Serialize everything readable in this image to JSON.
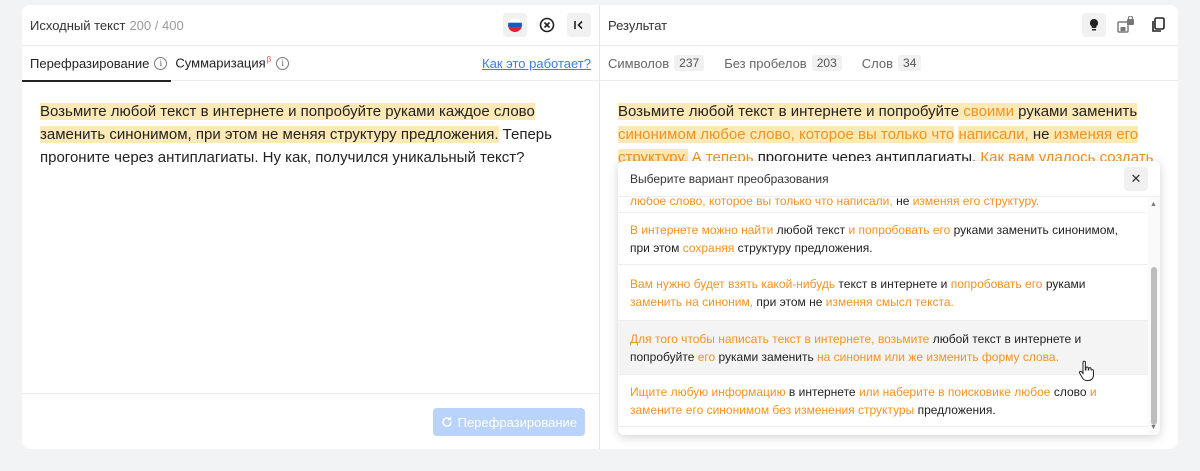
{
  "left": {
    "title": "Исходный текст",
    "counter": "200 / 400",
    "tabs": [
      {
        "label": "Перефразирование"
      },
      {
        "label": "Суммаризация",
        "badge": "β"
      }
    ],
    "how_link": "Как это работает?",
    "text_highlighted": "Возьмите любой текст в интернете и попробуйте руками каждое слово заменить синонимом, при этом не меняя структуру предложения.",
    "text_rest": " Теперь прогоните через антиплагиаты. Ну как, получился уникальный текст?",
    "button_label": "Перефразирование"
  },
  "right": {
    "title": "Результат",
    "stats": [
      {
        "label": "Символов",
        "value": "237"
      },
      {
        "label": "Без пробелов",
        "value": "203"
      },
      {
        "label": "Слов",
        "value": "34"
      }
    ],
    "result_segments": [
      {
        "t": "Возьмите любой текст в интернете и попробуйте ",
        "c": "hl"
      },
      {
        "t": "своими",
        "c": "hlo"
      },
      {
        "t": " руками заменить ",
        "c": "hl"
      },
      {
        "t": "синонимом любое слово, которое вы только что",
        "c": "hlo"
      },
      {
        "t": " ",
        "c": ""
      },
      {
        "t": "написали,",
        "c": "hlo"
      },
      {
        "t": " не ",
        "c": "hl"
      },
      {
        "t": "изменяя его",
        "c": "hlo"
      },
      {
        "t": " ",
        "c": ""
      },
      {
        "t": "структуру.",
        "c": "hlo"
      },
      {
        "t": " А теперь ",
        "c": "org"
      },
      {
        "t": "прогоните через антиплагиаты. ",
        "c": ""
      },
      {
        "t": "Как вам удалось создать",
        "c": "org"
      }
    ]
  },
  "dropdown": {
    "title": "Выберите вариант преобразования",
    "options": [
      [
        {
          "t": "любое слово, которое вы только что написали,",
          "o": true
        },
        {
          "t": " не ",
          "o": false
        },
        {
          "t": "изменяя его структуру.",
          "o": true
        }
      ],
      [
        {
          "t": "В интернете можно найти",
          "o": true
        },
        {
          "t": " любой текст ",
          "o": false
        },
        {
          "t": "и попробовать его",
          "o": true
        },
        {
          "t": " руками заменить синонимом, при этом ",
          "o": false
        },
        {
          "t": "сохраняя",
          "o": true
        },
        {
          "t": " структуру предложения.",
          "o": false
        }
      ],
      [
        {
          "t": "Вам нужно будет взять какой-нибудь",
          "o": true
        },
        {
          "t": " текст в интернете и ",
          "o": false
        },
        {
          "t": "попробовать его",
          "o": true
        },
        {
          "t": " руками ",
          "o": false
        },
        {
          "t": "заменить на синоним,",
          "o": true
        },
        {
          "t": " при этом не ",
          "o": false
        },
        {
          "t": "изменяя смысл текста.",
          "o": true
        }
      ],
      [
        {
          "t": "Для того чтобы написать текст в интернете, возьмите",
          "o": true
        },
        {
          "t": " любой текст в интернете и попробуйте ",
          "o": false
        },
        {
          "t": "его",
          "o": true
        },
        {
          "t": " руками заменить ",
          "o": false
        },
        {
          "t": "на синоним или же изменить форму слова.",
          "o": true
        }
      ],
      [
        {
          "t": "Ищите любую информацию",
          "o": true
        },
        {
          "t": " в интернете ",
          "o": false
        },
        {
          "t": "или наберите в поисковике любое",
          "o": true
        },
        {
          "t": " слово ",
          "o": false
        },
        {
          "t": "и замените его синонимом без изменения структуры",
          "o": true
        },
        {
          "t": " предложения.",
          "o": false
        }
      ]
    ]
  },
  "colors": {
    "accent_orange": "#f2931f",
    "highlight": "#fde9b6",
    "link": "#3a7de0",
    "button_disabled": "#b9d3fa"
  }
}
